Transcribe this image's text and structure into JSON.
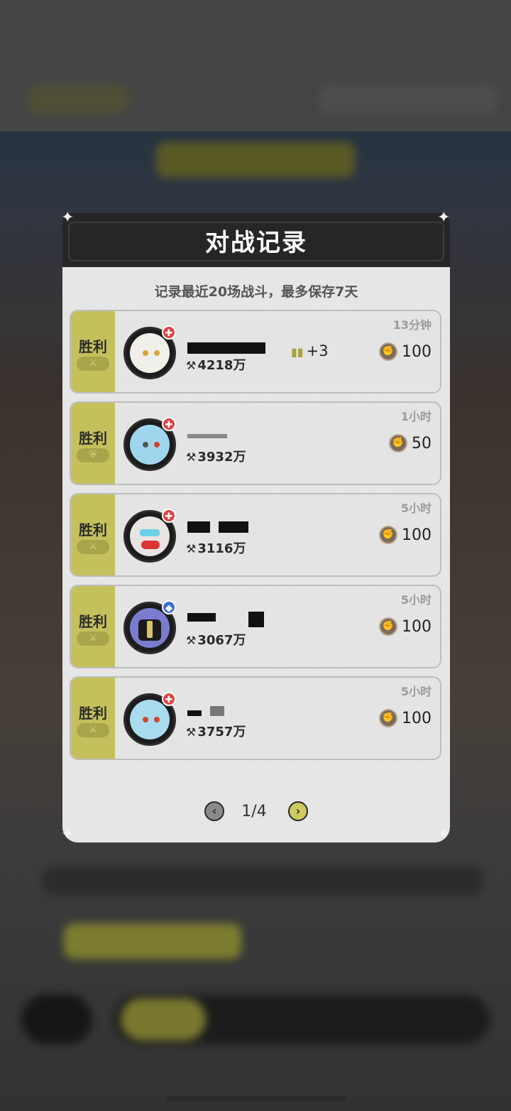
{
  "modal": {
    "title": "对战记录",
    "subtitle": "记录最近20场战斗，最多保存7天"
  },
  "records": [
    {
      "result": "胜利",
      "power": "4218万",
      "time": "13分钟",
      "reward": "100",
      "rank_change": "+3",
      "avatar_color": "#f1efe9",
      "badge_icon": "sword-icon"
    },
    {
      "result": "胜利",
      "power": "3932万",
      "time": "1小时",
      "reward": "50",
      "rank_change": "",
      "avatar_color": "#9fd6ee",
      "badge_icon": "shield-icon"
    },
    {
      "result": "胜利",
      "power": "3116万",
      "time": "5小时",
      "reward": "100",
      "rank_change": "",
      "avatar_color": "#d7b2ad",
      "badge_icon": "sword-icon"
    },
    {
      "result": "胜利",
      "power": "3067万",
      "time": "5小时",
      "reward": "100",
      "rank_change": "",
      "avatar_color": "#7b7bd0",
      "badge_icon": "sword-icon"
    },
    {
      "result": "胜利",
      "power": "3757万",
      "time": "5小时",
      "reward": "100",
      "rank_change": "",
      "avatar_color": "#a8dbee",
      "badge_icon": "sword-icon"
    }
  ],
  "pager": {
    "text": "1/4"
  },
  "colors": {
    "accent": "#c4c15d",
    "header": "#262626"
  }
}
